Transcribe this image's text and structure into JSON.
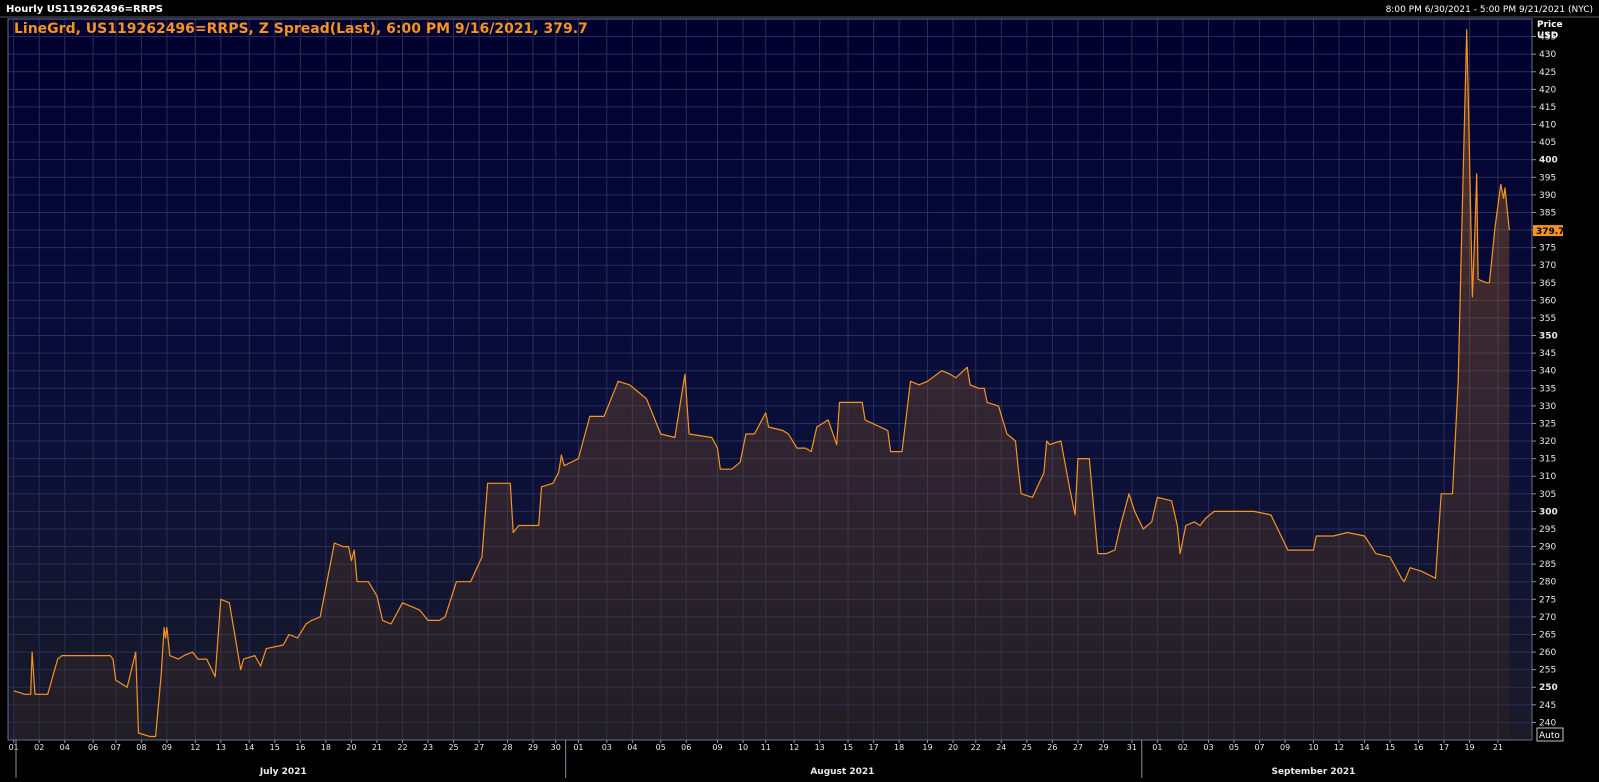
{
  "header": {
    "left": "Hourly US119262496=RRPS",
    "right": "8:00 PM 6/30/2021 - 5:00 PM 9/21/2021 (NYC)"
  },
  "legend": "LineGrd, US119262496=RRPS, Z Spread(Last), 6:00 PM 9/16/2021, 379.7",
  "axis": {
    "price_label": "Price",
    "currency_label": "USD",
    "auto_label": "Auto"
  },
  "colors": {
    "background": "#000035",
    "grid": "#2a2f57",
    "line": "#f7931e",
    "text": "#e8e8e8",
    "badge_text": "#000000"
  },
  "chart_data": {
    "type": "area",
    "series": [
      {
        "name": "Z Spread(Last)",
        "points": [
          [
            0.0,
            249
          ],
          [
            0.4,
            248
          ],
          [
            0.6,
            248
          ],
          [
            0.65,
            260
          ],
          [
            0.75,
            248
          ],
          [
            1.0,
            248
          ],
          [
            1.2,
            248
          ],
          [
            1.55,
            258
          ],
          [
            1.7,
            259
          ],
          [
            3.0,
            259
          ],
          [
            3.4,
            259
          ],
          [
            3.5,
            258
          ],
          [
            3.6,
            252
          ],
          [
            3.8,
            251
          ],
          [
            4.0,
            250
          ],
          [
            4.3,
            260
          ],
          [
            4.4,
            237
          ],
          [
            4.8,
            236
          ],
          [
            5.0,
            236
          ],
          [
            5.2,
            254
          ],
          [
            5.3,
            267
          ],
          [
            5.35,
            264
          ],
          [
            5.4,
            267
          ],
          [
            5.5,
            259
          ],
          [
            5.8,
            258
          ],
          [
            6.0,
            259
          ],
          [
            6.3,
            260
          ],
          [
            6.5,
            258
          ],
          [
            6.8,
            258
          ],
          [
            7.1,
            253
          ],
          [
            7.3,
            275
          ],
          [
            7.6,
            274
          ],
          [
            8.0,
            255
          ],
          [
            8.1,
            258
          ],
          [
            8.5,
            259
          ],
          [
            8.7,
            256
          ],
          [
            8.9,
            261
          ],
          [
            9.5,
            262
          ],
          [
            9.7,
            265
          ],
          [
            10.0,
            264
          ],
          [
            10.3,
            268
          ],
          [
            10.5,
            269
          ],
          [
            10.8,
            270
          ],
          [
            11.3,
            291
          ],
          [
            11.6,
            290
          ],
          [
            11.8,
            290
          ],
          [
            11.9,
            286
          ],
          [
            12.0,
            289
          ],
          [
            12.1,
            280
          ],
          [
            12.5,
            280
          ],
          [
            12.8,
            276
          ],
          [
            13.0,
            269
          ],
          [
            13.3,
            268
          ],
          [
            13.7,
            274
          ],
          [
            14.3,
            272
          ],
          [
            14.6,
            269
          ],
          [
            15.0,
            269
          ],
          [
            15.2,
            270
          ],
          [
            15.6,
            280
          ],
          [
            16.1,
            280
          ],
          [
            16.5,
            287
          ],
          [
            16.7,
            308
          ],
          [
            17.5,
            308
          ],
          [
            17.6,
            294
          ],
          [
            17.8,
            296
          ],
          [
            18.5,
            296
          ],
          [
            18.6,
            307
          ],
          [
            19.0,
            308
          ],
          [
            19.2,
            311
          ],
          [
            19.3,
            316
          ],
          [
            19.4,
            313
          ],
          [
            19.9,
            315
          ],
          [
            20.3,
            327
          ],
          [
            20.8,
            327
          ],
          [
            21.3,
            337
          ],
          [
            21.7,
            336
          ],
          [
            22.3,
            332
          ],
          [
            22.8,
            322
          ],
          [
            23.3,
            321
          ],
          [
            23.65,
            339
          ],
          [
            23.8,
            322
          ],
          [
            24.6,
            321
          ],
          [
            24.8,
            318
          ],
          [
            24.9,
            312
          ],
          [
            25.3,
            312
          ],
          [
            25.6,
            314
          ],
          [
            25.8,
            322
          ],
          [
            26.1,
            322
          ],
          [
            26.5,
            328
          ],
          [
            26.6,
            324
          ],
          [
            27.1,
            323
          ],
          [
            27.3,
            322
          ],
          [
            27.6,
            318
          ],
          [
            27.9,
            318
          ],
          [
            28.1,
            317
          ],
          [
            28.3,
            324
          ],
          [
            28.7,
            326
          ],
          [
            29.0,
            319
          ],
          [
            29.1,
            331
          ],
          [
            29.5,
            331
          ],
          [
            29.9,
            331
          ],
          [
            30.0,
            326
          ],
          [
            30.8,
            323
          ],
          [
            30.9,
            317
          ],
          [
            31.3,
            317
          ],
          [
            31.6,
            337
          ],
          [
            31.9,
            336
          ],
          [
            32.2,
            337
          ],
          [
            32.7,
            340
          ],
          [
            33.0,
            339
          ],
          [
            33.2,
            338
          ],
          [
            33.6,
            341
          ],
          [
            33.7,
            336
          ],
          [
            34.0,
            335
          ],
          [
            34.2,
            335
          ],
          [
            34.3,
            331
          ],
          [
            34.7,
            330
          ],
          [
            35.0,
            322
          ],
          [
            35.3,
            320
          ],
          [
            35.4,
            312
          ],
          [
            35.5,
            305
          ],
          [
            35.9,
            304
          ],
          [
            36.3,
            311
          ],
          [
            36.4,
            320
          ],
          [
            36.5,
            319
          ],
          [
            36.9,
            320
          ],
          [
            37.2,
            307
          ],
          [
            37.4,
            299
          ],
          [
            37.5,
            315
          ],
          [
            37.9,
            315
          ],
          [
            38.2,
            288
          ],
          [
            38.5,
            288
          ],
          [
            38.8,
            289
          ],
          [
            39.0,
            296
          ],
          [
            39.3,
            305
          ],
          [
            39.5,
            300
          ],
          [
            39.8,
            295
          ],
          [
            40.1,
            297
          ],
          [
            40.3,
            304
          ],
          [
            40.8,
            303
          ],
          [
            41.0,
            296
          ],
          [
            41.1,
            288
          ],
          [
            41.3,
            296
          ],
          [
            41.6,
            297
          ],
          [
            41.8,
            296
          ],
          [
            42.0,
            298
          ],
          [
            42.3,
            300
          ],
          [
            43.0,
            300
          ],
          [
            43.7,
            300
          ],
          [
            44.3,
            299
          ],
          [
            44.9,
            289
          ],
          [
            45.2,
            289
          ],
          [
            45.8,
            289
          ],
          [
            45.9,
            293
          ],
          [
            46.5,
            293
          ],
          [
            47.0,
            294
          ],
          [
            47.6,
            293
          ],
          [
            48.0,
            288
          ],
          [
            48.5,
            287
          ],
          [
            48.9,
            281
          ],
          [
            49.0,
            280
          ],
          [
            49.2,
            284
          ],
          [
            49.6,
            283
          ],
          [
            50.1,
            281
          ],
          [
            50.3,
            305
          ],
          [
            50.7,
            305
          ],
          [
            50.9,
            337
          ],
          [
            51.0,
            372
          ],
          [
            51.2,
            437
          ],
          [
            51.25,
            420
          ],
          [
            51.4,
            361
          ],
          [
            51.5,
            382
          ],
          [
            51.55,
            396
          ],
          [
            51.6,
            366
          ],
          [
            51.9,
            365
          ],
          [
            52.0,
            365
          ],
          [
            52.2,
            381
          ],
          [
            52.4,
            393
          ],
          [
            52.5,
            389
          ],
          [
            52.55,
            392
          ],
          [
            52.7,
            380
          ]
        ]
      }
    ],
    "x_tick_labels": [
      "01",
      "02",
      "04",
      "06",
      "07",
      "08",
      "09",
      "12",
      "13",
      "14",
      "15",
      "16",
      "18",
      "20",
      "21",
      "22",
      "23",
      "25",
      "27",
      "28",
      "29",
      "30",
      "01",
      "03",
      "04",
      "05",
      "06",
      "09",
      "10",
      "11",
      "12",
      "13",
      "15",
      "17",
      "18",
      "19",
      "20",
      "22",
      "24",
      "25",
      "26",
      "27",
      "29",
      "31",
      "01",
      "02",
      "03",
      "05",
      "07",
      "09",
      "10",
      "12",
      "14",
      "15",
      "16",
      "17",
      "19",
      "21"
    ],
    "x_tick_days": [
      0,
      1,
      3,
      5,
      6,
      7,
      8,
      11,
      12,
      13,
      14,
      15,
      17,
      19,
      20,
      21,
      22,
      24,
      26,
      27,
      28,
      29,
      31,
      33,
      34,
      35,
      36,
      39,
      40,
      41,
      42,
      43,
      45,
      47,
      48,
      49,
      50,
      52,
      54,
      55,
      56,
      57,
      59,
      61,
      62,
      63,
      64,
      66,
      68,
      70,
      71,
      73,
      75,
      76,
      77,
      78,
      80,
      82
    ],
    "x_tick_positions": [
      0.0,
      0.9,
      1.8,
      2.8,
      3.6,
      4.5,
      5.4,
      6.4,
      7.3,
      8.3,
      9.2,
      10.1,
      11.0,
      11.9,
      12.8,
      13.7,
      14.6,
      15.5,
      16.4,
      17.4,
      18.3,
      19.1,
      19.9,
      20.9,
      21.8,
      22.8,
      23.7,
      24.8,
      25.7,
      26.5,
      27.5,
      28.4,
      29.4,
      30.3,
      31.2,
      32.2,
      33.1,
      33.9,
      34.8,
      35.7,
      36.6,
      37.5,
      38.4,
      39.4,
      40.3,
      41.2,
      42.1,
      43.0,
      43.9,
      44.8,
      45.8,
      46.7,
      47.6,
      48.5,
      49.5,
      50.4,
      51.3,
      52.3
    ],
    "months": [
      {
        "label": "July 2021",
        "center": 9.5
      },
      {
        "label": "August 2021",
        "center": 29.2
      },
      {
        "label": "September 2021",
        "center": 45.8
      }
    ],
    "month_separators": [
      19.45,
      39.75
    ],
    "xlim": [
      -0.2,
      53.5
    ],
    "ylim": [
      235,
      440
    ],
    "y_ticks": [
      240,
      245,
      250,
      255,
      260,
      265,
      270,
      275,
      280,
      285,
      290,
      295,
      300,
      305,
      310,
      315,
      320,
      325,
      330,
      335,
      340,
      345,
      350,
      355,
      360,
      365,
      370,
      375,
      380,
      385,
      390,
      395,
      400,
      405,
      410,
      415,
      420,
      425,
      430,
      435
    ],
    "y_major": [
      250,
      300,
      350,
      400
    ],
    "last_value": 379.7,
    "last_value_label": "379.7",
    "grid": true
  }
}
